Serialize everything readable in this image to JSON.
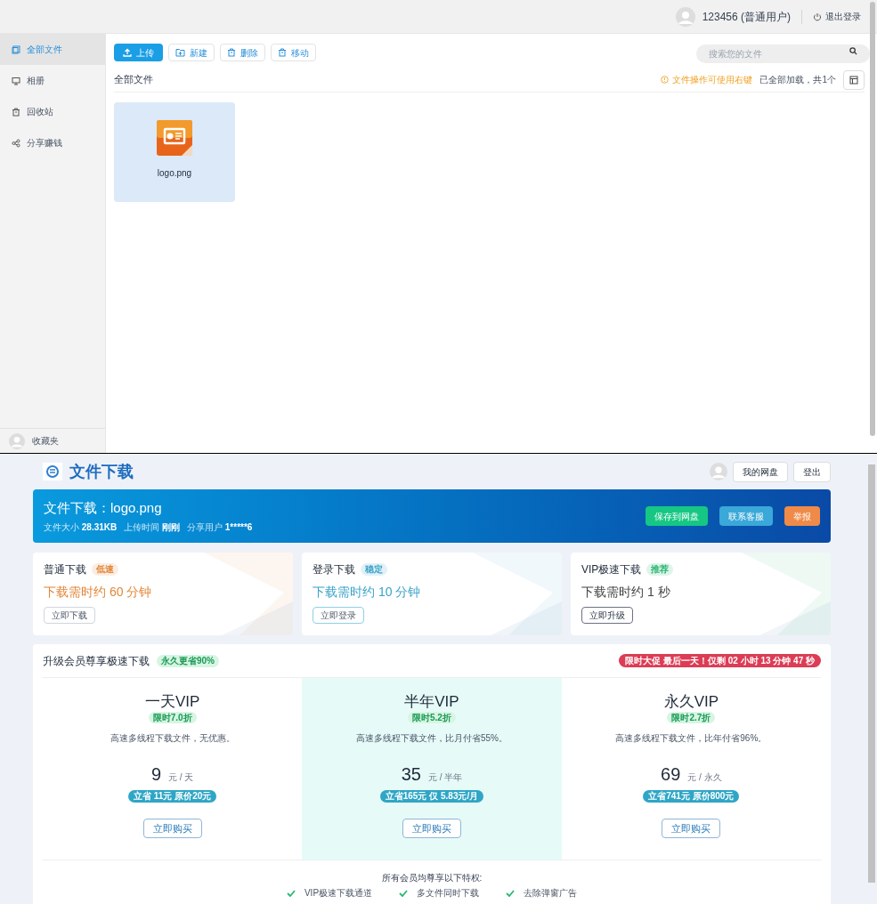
{
  "header": {
    "user": "123456 (普通用户)",
    "logout": "退出登录"
  },
  "sidebar": {
    "items": [
      {
        "label": "全部文件",
        "selected": true
      },
      {
        "label": "相册",
        "selected": false
      },
      {
        "label": "回收站",
        "selected": false
      },
      {
        "label": "分享赚钱",
        "selected": false
      }
    ],
    "footer": "收藏夹"
  },
  "toolbar": {
    "buttons": [
      {
        "label": "上传",
        "kind": "primary"
      },
      {
        "label": "新建",
        "kind": "plain"
      },
      {
        "label": "删除",
        "kind": "plain"
      },
      {
        "label": "移动",
        "kind": "plain"
      }
    ],
    "search": {
      "placeholder": "搜索您的文件"
    }
  },
  "breadcrumb": "全部文件",
  "tip": "文件操作可使用右键",
  "load_status": "已全部加载，共1个",
  "files": [
    {
      "name": "logo.png",
      "selected": true
    }
  ],
  "download_page": {
    "brand": "文件下载",
    "nav_buttons": [
      "我的网盘",
      "登出"
    ],
    "banner": {
      "title": "文件下载：logo.png",
      "meta": [
        {
          "label": "文件大小",
          "value": "28.31KB"
        },
        {
          "label": "上传时间",
          "value": "刚刚"
        },
        {
          "label": "分享用户",
          "value": "1*****6"
        }
      ],
      "actions": [
        {
          "label": "保存到网盘",
          "color": "#16c784"
        },
        {
          "label": "联系客服",
          "color": "#3aa8d8"
        },
        {
          "label": "举报",
          "color": "#f08a48"
        }
      ]
    },
    "options": [
      {
        "title": "普通下载",
        "badge": "低速",
        "time": "下载需时约 60 分钟",
        "button": "立即下载",
        "color": "#e2873a"
      },
      {
        "title": "登录下载",
        "badge": "稳定",
        "time": "下载需时约 10 分钟",
        "button": "立即登录",
        "color": "#3aa3c9"
      },
      {
        "title": "VIP极速下载",
        "badge": "推荐",
        "time": "下载需时约 1 秒",
        "button": "立即升级",
        "color": "#2bb673"
      }
    ],
    "upgrade": {
      "title": "升级会员尊享极速下载",
      "badge": "永久更省90%",
      "countdown": "限时大促 最后一天！仅剩 02 小时 13 分钟 47 秒",
      "plans": [
        {
          "name": "一天VIP",
          "discount": "限时7.0折",
          "desc": "高速多线程下载文件，无优惠。",
          "price": "9",
          "unit": "元 / 天",
          "savings": "立省 11元 原价20元",
          "button": "立即购买",
          "selected": false
        },
        {
          "name": "半年VIP",
          "discount": "限时5.2折",
          "desc": "高速多线程下载文件，比月付省55%。",
          "price": "35",
          "unit": "元 / 半年",
          "savings": "立省165元 仅 5.83元/月",
          "button": "立即购买",
          "selected": true
        },
        {
          "name": "永久VIP",
          "discount": "限时2.7折",
          "desc": "高速多线程下载文件，比年付省96%。",
          "price": "69",
          "unit": "元 / 永久",
          "savings": "立省741元 原价800元",
          "button": "立即购买",
          "selected": false
        }
      ],
      "perks_title": "所有会员均尊享以下特权:",
      "perks": [
        "VIP极速下载通道",
        "多文件同时下载",
        "去除弹窗广告"
      ]
    }
  }
}
